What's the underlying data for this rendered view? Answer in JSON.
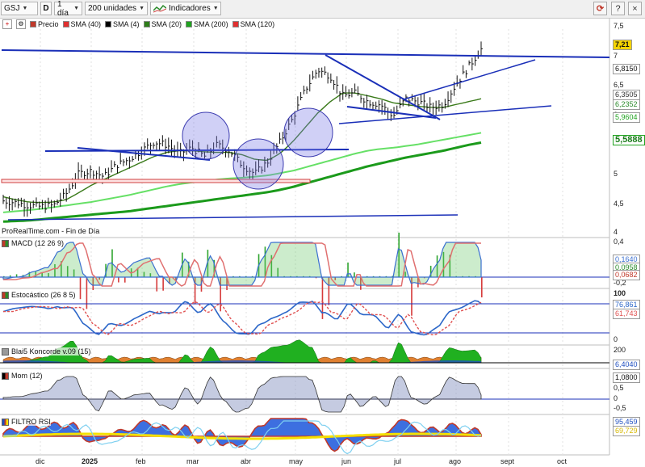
{
  "toolbar": {
    "symbol": "GSJ",
    "timeframe": "1 día",
    "units": "200 unidades",
    "indicators_label": "Indicadores",
    "help_label": "?"
  },
  "legend": {
    "items": [
      {
        "label": "Precio",
        "color": "#c0392b"
      },
      {
        "label": "SMA (40)",
        "color": "#e03030"
      },
      {
        "label": "SMA (4)",
        "color": "#000000"
      },
      {
        "label": "SMA (20)",
        "color": "#2e7d1a"
      },
      {
        "label": "SMA (200)",
        "color": "#1fa31f"
      },
      {
        "label": "SMA (120)",
        "color": "#e03030"
      }
    ]
  },
  "price_panel": {
    "source_text": "ProRealTime.com - Fin de Día",
    "scale": [
      "7,5",
      "7",
      "6,5",
      "6",
      "5,5",
      "5",
      "4,5",
      "4"
    ],
    "tags": [
      {
        "text": "7,21",
        "color": "#f5d400"
      },
      {
        "text": "6,8150",
        "color": "#ffffff"
      },
      {
        "text": "6,3505",
        "color": "#ffffff"
      },
      {
        "text": "6,2352",
        "color": "#ffffff"
      },
      {
        "text": "5,9604",
        "color": "#ffffff"
      },
      {
        "text": "5,5888",
        "color": "#ffffff"
      }
    ]
  },
  "panels": {
    "macd": {
      "label": "MACD (12 26 9)",
      "scale": [
        "0,4",
        "-0,2"
      ],
      "tags": [
        "0,1640",
        "0,0958",
        "0,0682"
      ]
    },
    "stoch": {
      "label": "Estocástico (26 8 5)",
      "scale": [
        "100",
        "0"
      ],
      "tags": [
        "76,861",
        "61,743"
      ]
    },
    "koncorde": {
      "label": "Blai5 Koncorde v.09 (15)",
      "scale": [
        "200"
      ],
      "tags": [
        "6,4040"
      ]
    },
    "mom": {
      "label": "Mom (12)",
      "scale": [
        "1",
        "0,5",
        "0",
        "-0,5"
      ],
      "tags": [
        "1,0800"
      ]
    },
    "rsi": {
      "label": "FILTRO RSI",
      "scale": [],
      "tags": [
        "95,459",
        "69,729"
      ]
    }
  },
  "x_axis": {
    "labels": [
      "dic",
      "2025",
      "feb",
      "mar",
      "abr",
      "may",
      "jun",
      "jul",
      "ago",
      "sept",
      "oct"
    ]
  },
  "chart_data": {
    "type": "line",
    "title": "",
    "ylim": [
      4,
      7.6
    ],
    "series": [
      {
        "name": "Precio",
        "values": [
          4.58,
          4.55,
          4.5,
          4.48,
          4.5,
          4.7,
          5.05,
          5.1,
          5.0,
          5.2,
          5.3,
          5.45,
          5.6,
          5.55,
          5.4,
          5.5,
          5.35,
          5.55,
          5.45,
          5.2,
          5.05,
          5.25,
          5.6,
          6.0,
          6.5,
          6.85,
          6.75,
          6.4,
          6.45,
          6.3,
          6.25,
          6.05,
          6.35,
          6.3,
          6.2,
          6.25,
          6.6,
          6.9,
          7.21
        ]
      },
      {
        "name": "SMA (20)",
        "values": [
          4.65,
          4.6,
          4.56,
          4.55,
          4.56,
          4.6,
          4.72,
          4.85,
          4.95,
          5.05,
          5.15,
          5.25,
          5.35,
          5.42,
          5.45,
          5.45,
          5.43,
          5.42,
          5.42,
          5.38,
          5.3,
          5.28,
          5.4,
          5.6,
          5.85,
          6.1,
          6.3,
          6.45,
          6.45,
          6.4,
          6.35,
          6.28,
          6.25,
          6.22,
          6.2,
          6.2,
          6.25,
          6.3,
          6.35
        ]
      },
      {
        "name": "SMA (120)",
        "values": [
          4.38,
          4.4,
          4.42,
          4.44,
          4.47,
          4.5,
          4.53,
          4.56,
          4.6,
          4.64,
          4.68,
          4.73,
          4.78,
          4.83,
          4.87,
          4.9,
          4.92,
          4.95,
          4.97,
          4.98,
          5.0,
          5.02,
          5.06,
          5.1,
          5.16,
          5.22,
          5.28,
          5.34,
          5.4,
          5.45,
          5.48,
          5.5,
          5.53,
          5.56,
          5.6,
          5.64,
          5.68,
          5.72,
          5.76
        ]
      },
      {
        "name": "SMA (200)",
        "values": [
          4.22,
          4.23,
          4.24,
          4.26,
          4.28,
          4.3,
          4.32,
          4.34,
          4.36,
          4.38,
          4.4,
          4.43,
          4.46,
          4.49,
          4.52,
          4.55,
          4.58,
          4.61,
          4.64,
          4.67,
          4.7,
          4.73,
          4.77,
          4.82,
          4.88,
          4.94,
          5.0,
          5.06,
          5.12,
          5.18,
          5.23,
          5.28,
          5.33,
          5.37,
          5.41,
          5.45,
          5.5,
          5.55,
          5.59
        ]
      }
    ]
  }
}
